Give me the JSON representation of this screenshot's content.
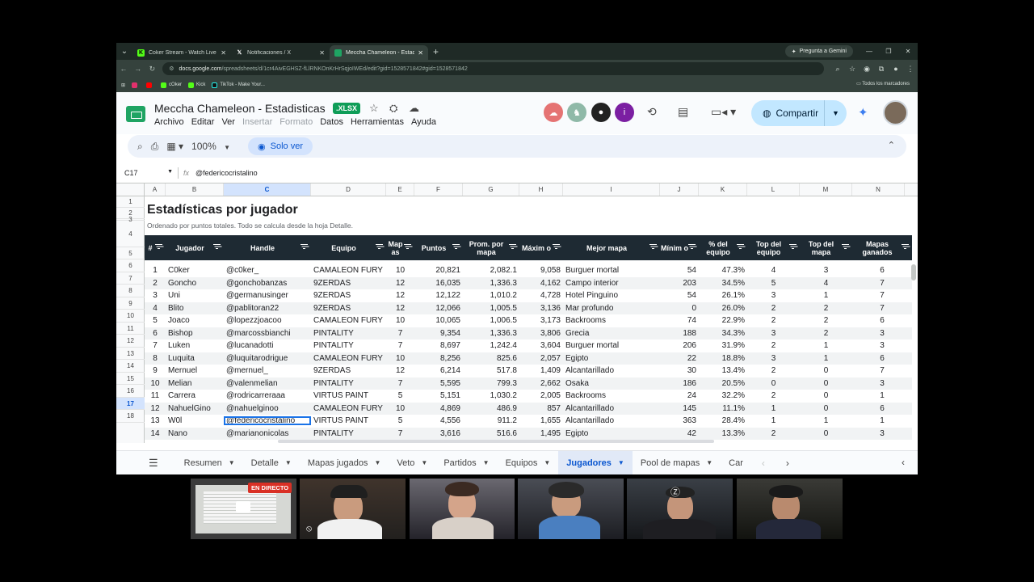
{
  "browser": {
    "tabs": [
      {
        "title": "Coker Stream - Watch Live on Kick",
        "favicon": "kick-icon",
        "active": false
      },
      {
        "title": "Notificaciones / X",
        "favicon": "x-icon",
        "active": false
      },
      {
        "title": "Meccha Chameleon - Estadísticas",
        "favicon": "sheets-icon",
        "active": true
      }
    ],
    "gemini_button": "Pregunta a Gemini",
    "url_host": "docs.google.com",
    "url_path": "/spreadsheets/d/1cr4AivEGHSZ-fLlRNKOnKrHrSqjoIWEd/edit?gid=1528571842#gid=1528571842",
    "bookmarks": [
      "cOker",
      "Kick",
      "TikTok - Make Your..."
    ],
    "bookmarks_right": "Todos los marcadores"
  },
  "doc": {
    "title": "Meccha Chameleon - Estadisticas",
    "badge": ".XLSX",
    "menu": [
      {
        "label": "Archivo",
        "disabled": false
      },
      {
        "label": "Editar",
        "disabled": false
      },
      {
        "label": "Ver",
        "disabled": false
      },
      {
        "label": "Insertar",
        "disabled": true
      },
      {
        "label": "Formato",
        "disabled": true
      },
      {
        "label": "Datos",
        "disabled": false
      },
      {
        "label": "Herramientas",
        "disabled": false
      },
      {
        "label": "Ayuda",
        "disabled": false
      }
    ],
    "share_label": "Compartir"
  },
  "toolbar": {
    "zoom": "100%",
    "mode_label": "Solo ver"
  },
  "formula_bar": {
    "cell_ref": "C17",
    "content": "@federicocristalino"
  },
  "columns": [
    "A",
    "B",
    "C",
    "D",
    "E",
    "F",
    "G",
    "H",
    "I",
    "J",
    "K",
    "L",
    "M",
    "N"
  ],
  "row_numbers": [
    "1",
    "2",
    "3",
    "4",
    "5",
    "6",
    "7",
    "8",
    "9",
    "10",
    "11",
    "12",
    "13",
    "14",
    "15",
    "16",
    "17",
    "18"
  ],
  "sheet": {
    "title": "Estadísticas por jugador",
    "subtitle": "Ordenado por puntos totales. Todo se calcula desde la hoja Detalle.",
    "headers": [
      "#",
      "Jugador",
      "Handle",
      "Equipo",
      "Map as",
      "Puntos",
      "Prom. por mapa",
      "Máxim o",
      "Mejor mapa",
      "Mínim o",
      "% del equipo",
      "Top del equipo",
      "Top del mapa",
      "Mapas ganados"
    ],
    "rows": [
      [
        "1",
        "C0ker",
        "@c0ker_",
        "CAMALEON FURY",
        "10",
        "20,821",
        "2,082.1",
        "9,058",
        "Burguer mortal",
        "54",
        "47.3%",
        "4",
        "3",
        "6"
      ],
      [
        "2",
        "Goncho",
        "@gonchobanzas",
        "9ZERDAS",
        "12",
        "16,035",
        "1,336.3",
        "4,162",
        "Campo interior",
        "203",
        "34.5%",
        "5",
        "4",
        "7"
      ],
      [
        "3",
        "Uni",
        "@germanusinger",
        "9ZERDAS",
        "12",
        "12,122",
        "1,010.2",
        "4,728",
        "Hotel Pinguino",
        "54",
        "26.1%",
        "3",
        "1",
        "7"
      ],
      [
        "4",
        "Blito",
        "@pablitoran22",
        "9ZERDAS",
        "12",
        "12,066",
        "1,005.5",
        "3,136",
        "Mar profundo",
        "0",
        "26.0%",
        "2",
        "2",
        "7"
      ],
      [
        "5",
        "Joaco",
        "@lopezzjoacoo",
        "CAMALEON FURY",
        "10",
        "10,065",
        "1,006.5",
        "3,173",
        "Backrooms",
        "74",
        "22.9%",
        "2",
        "2",
        "6"
      ],
      [
        "6",
        "Bishop",
        "@marcossbianchi",
        "PINTALITY",
        "7",
        "9,354",
        "1,336.3",
        "3,806",
        "Grecia",
        "188",
        "34.3%",
        "3",
        "2",
        "3"
      ],
      [
        "7",
        "Luken",
        "@lucanadotti",
        "PINTALITY",
        "7",
        "8,697",
        "1,242.4",
        "3,604",
        "Burguer mortal",
        "206",
        "31.9%",
        "2",
        "1",
        "3"
      ],
      [
        "8",
        "Luquita",
        "@luquitarodrigue",
        "CAMALEON FURY",
        "10",
        "8,256",
        "825.6",
        "2,057",
        "Egipto",
        "22",
        "18.8%",
        "3",
        "1",
        "6"
      ],
      [
        "9",
        "Mernuel",
        "@mernuel_",
        "9ZERDAS",
        "12",
        "6,214",
        "517.8",
        "1,409",
        "Alcantarillado",
        "30",
        "13.4%",
        "2",
        "0",
        "7"
      ],
      [
        "10",
        "Melian",
        "@valenmelian",
        "PINTALITY",
        "7",
        "5,595",
        "799.3",
        "2,662",
        "Osaka",
        "186",
        "20.5%",
        "0",
        "0",
        "3"
      ],
      [
        "11",
        "Carrera",
        "@rodricarreraaa",
        "VIRTUS PAINT",
        "5",
        "5,151",
        "1,030.2",
        "2,005",
        "Backrooms",
        "24",
        "32.2%",
        "2",
        "0",
        "1"
      ],
      [
        "12",
        "NahuelGino",
        "@nahuelginoo",
        "CAMALEON FURY",
        "10",
        "4,869",
        "486.9",
        "857",
        "Alcantarillado",
        "145",
        "11.1%",
        "1",
        "0",
        "6"
      ],
      [
        "13",
        "W0l",
        "@federicocristalino",
        "VIRTUS PAINT",
        "5",
        "4,556",
        "911.2",
        "1,655",
        "Alcantarillado",
        "363",
        "28.4%",
        "1",
        "1",
        "1"
      ],
      [
        "14",
        "Nano",
        "@marianonicolas",
        "PINTALITY",
        "7",
        "3,616",
        "516.6",
        "1,495",
        "Egipto",
        "42",
        "13.3%",
        "2",
        "0",
        "3"
      ]
    ]
  },
  "sheet_tabs": [
    {
      "label": "Resumen",
      "active": false
    },
    {
      "label": "Detalle",
      "active": false
    },
    {
      "label": "Mapas jugados",
      "active": false
    },
    {
      "label": "Veto",
      "active": false
    },
    {
      "label": "Partidos",
      "active": false
    },
    {
      "label": "Equipos",
      "active": false
    },
    {
      "label": "Jugadores",
      "active": true
    },
    {
      "label": "Pool de mapas",
      "active": false
    },
    {
      "label": "Car",
      "active": false
    }
  ],
  "stream": {
    "live_badge": "EN DIRECTO"
  },
  "colors": {
    "header_dark": "#1e2a33",
    "selection_blue": "#1a73e8",
    "share_bg": "#c2e7ff",
    "sheets_green": "#1fa463"
  }
}
